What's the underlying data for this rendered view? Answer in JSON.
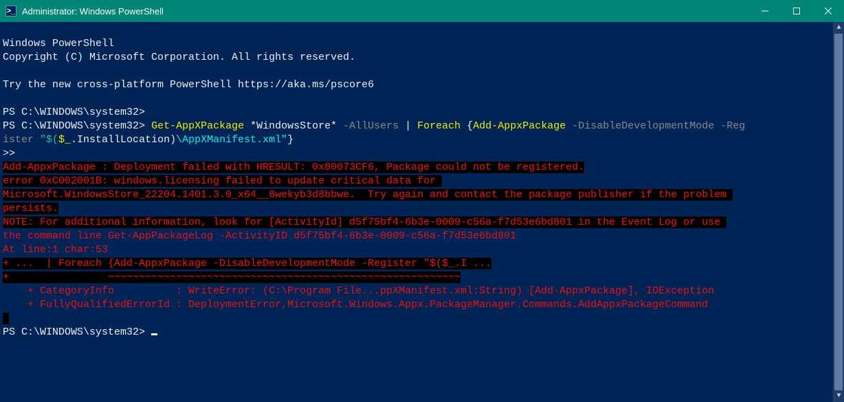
{
  "titlebar": {
    "icon_glyph": ">_",
    "title": "Administrator: Windows PowerShell"
  },
  "console": {
    "header1": "Windows PowerShell",
    "header2": "Copyright (C) Microsoft Corporation. All rights reserved.",
    "try_line": "Try the new cross-platform PowerShell https://aka.ms/pscore6",
    "prompt": "PS C:\\WINDOWS\\system32>",
    "cmd": {
      "p1": "Get-AppXPackage",
      "p2": " *WindowsStore* ",
      "p3": "-AllUsers",
      "pipe": " | ",
      "p4": "Foreach",
      "brace_open": " {",
      "p5": "Add-AppxPackage",
      "p6": " -DisableDevelopmentMode -Reg",
      "p6b": "ister ",
      "q1": "\"$(",
      "var": "$_",
      "dot": ".InstallLocation",
      "q2": ")",
      "path": "\\AppXManifest.xml\"",
      "brace_close": "}"
    },
    "cont": ">>",
    "err": {
      "e1": "Add-AppxPackage : Deployment failed with HRESULT: 0x80073CF6, Package could not be registered.",
      "e2a": "error 0xC002001B: windows.licensing failed to update critical data for ",
      "e3a": "Microsoft.WindowsStore_22204.1401.3.0_x64__8wekyb3d8bbwe.  Try again and contact the package publisher if the problem ",
      "e3b": "persists.",
      "e4": "NOTE: For additional information, look for [ActivityId] d5f75bf4-6b3e-0009-c56a-f7d53e6bd801 in the Event Log or use ",
      "e5": "the command line Get-AppPackageLog -ActivityID d5f75bf4-6b3e-0009-c56a-f7d53e6bd801",
      "e6": "At line:1 char:53",
      "e7": "+ ...  | Foreach {Add-AppxPackage -DisableDevelopmentMode -Register \"$($_.I ...",
      "e8": "+                ~~~~~~~~~~~~~~~~~~~~~~~~~~~~~~~~~~~~~~~~~~~~~~~~~~~~~~~~~",
      "e9": "    + CategoryInfo          : WriteError: (C:\\Program File...ppXManifest.xml:String) [Add-AppxPackage], IOException",
      "e10": "    + FullyQualifiedErrorId : DeploymentError,Microsoft.Windows.Appx.PackageManager.Commands.AddAppxPackageCommand"
    }
  }
}
